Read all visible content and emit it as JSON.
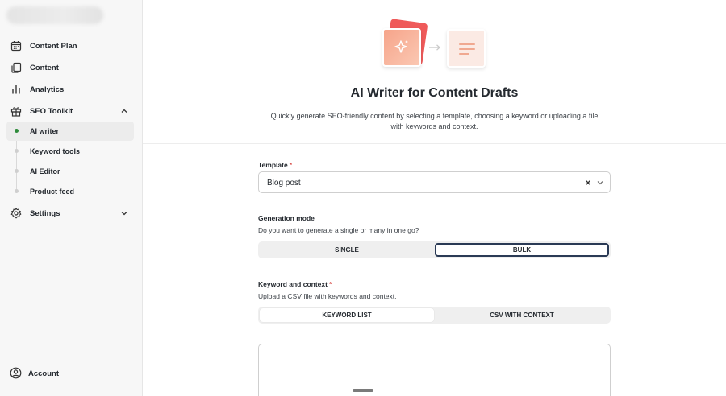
{
  "sidebar": {
    "items": [
      {
        "label": "Content Plan",
        "icon": "calendar-icon"
      },
      {
        "label": "Content",
        "icon": "copy-icon"
      },
      {
        "label": "Analytics",
        "icon": "bar-chart-icon"
      },
      {
        "label": "SEO Toolkit",
        "icon": "gift-icon"
      },
      {
        "label": "Settings",
        "icon": "gear-icon"
      }
    ],
    "sub_items": [
      {
        "label": "AI writer",
        "active": true
      },
      {
        "label": "Keyword tools"
      },
      {
        "label": "AI Editor"
      },
      {
        "label": "Product feed"
      }
    ],
    "account_label": "Account"
  },
  "hero": {
    "title": "AI Writer for Content Drafts",
    "description": "Quickly generate SEO-friendly content by selecting a template, choosing a keyword or uploading a file with keywords and context."
  },
  "form": {
    "template": {
      "label": "Template",
      "required_mark": "*",
      "value": "Blog post"
    },
    "generation_mode": {
      "label": "Generation mode",
      "help": "Do you want to generate a single or many in one go?",
      "options": [
        "SINGLE",
        "BULK"
      ],
      "selected": "BULK"
    },
    "keyword_context": {
      "label": "Keyword and context",
      "required_mark": "*",
      "help": "Upload a CSV file with keywords and context.",
      "options": [
        "KEYWORD LIST",
        "CSV WITH CONTEXT"
      ],
      "selected": "KEYWORD LIST"
    }
  },
  "colors": {
    "active_dot": "#2e8b3b",
    "required": "#d9534f",
    "selected_outline": "#2a3a55",
    "accent_card": "#ef5a5a"
  }
}
